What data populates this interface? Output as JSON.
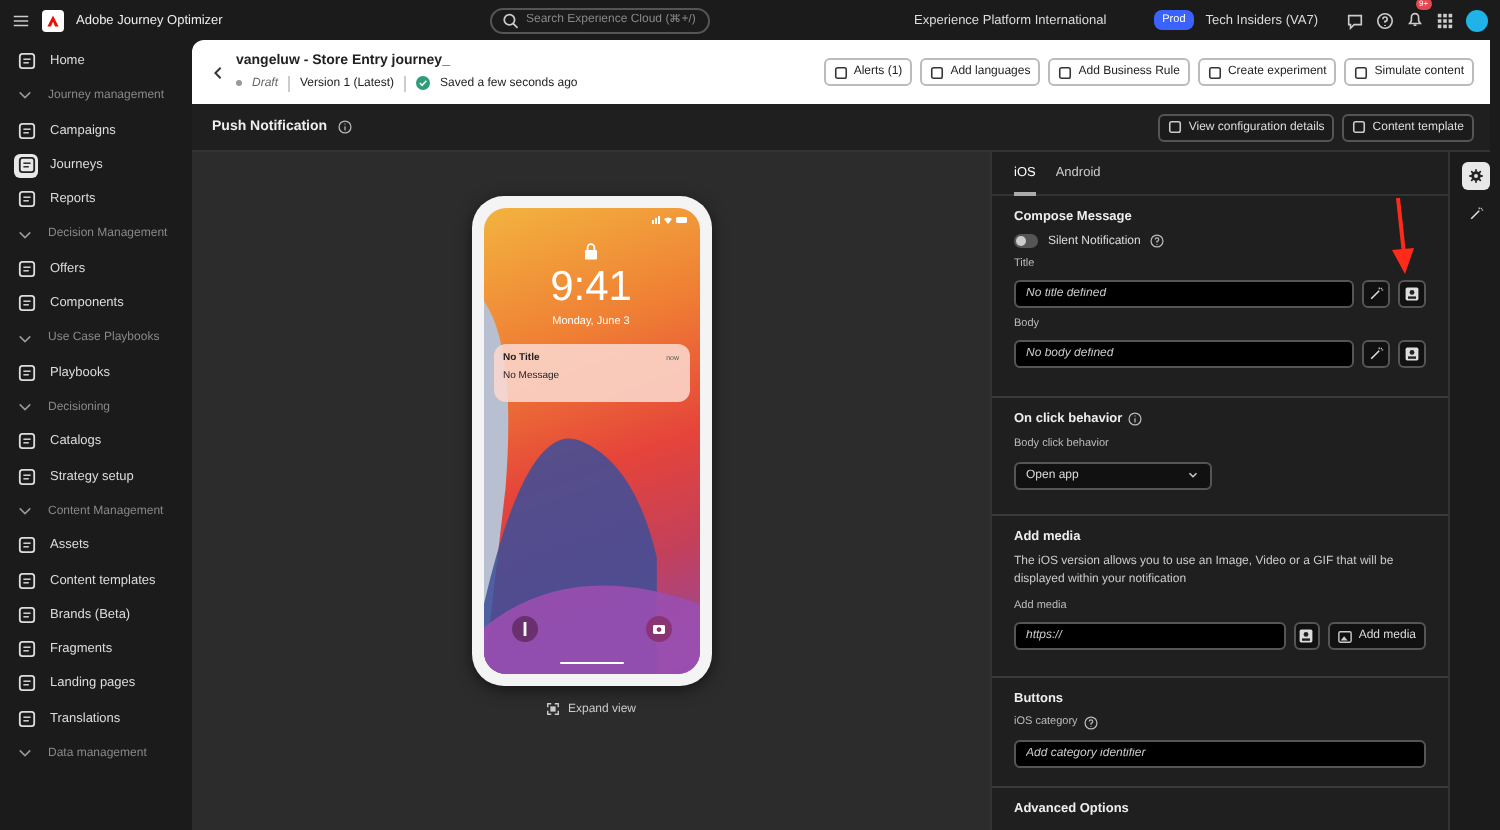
{
  "top_bar": {
    "app_name": "Adobe Journey Optimizer",
    "search": {
      "placeholder": "Search Experience Cloud (⌘+/)"
    },
    "org": "Experience Platform International",
    "env_badge": "Prod",
    "sandbox": "Tech Insiders (VA7)",
    "notification_count": "9+"
  },
  "sidebar": {
    "items": [
      {
        "kind": "item",
        "label": "Home",
        "selected": false
      },
      {
        "kind": "heading",
        "label": "Journey management",
        "expanded": true
      },
      {
        "kind": "item",
        "label": "Campaigns",
        "selected": false
      },
      {
        "kind": "item",
        "label": "Journeys",
        "selected": true
      },
      {
        "kind": "item",
        "label": "Reports",
        "selected": false
      },
      {
        "kind": "heading",
        "label": "Decision Management",
        "expanded": true
      },
      {
        "kind": "item",
        "label": "Offers",
        "selected": false
      },
      {
        "kind": "item",
        "label": "Components",
        "selected": false
      },
      {
        "kind": "heading",
        "label": "Use Case Playbooks",
        "expanded": true
      },
      {
        "kind": "item",
        "label": "Playbooks",
        "selected": false
      },
      {
        "kind": "heading",
        "label": "Decisioning",
        "expanded": true
      },
      {
        "kind": "item",
        "label": "Catalogs",
        "selected": false
      },
      {
        "kind": "item",
        "label": "Strategy setup",
        "selected": false
      },
      {
        "kind": "heading",
        "label": "Content Management",
        "expanded": true
      },
      {
        "kind": "item",
        "label": "Assets",
        "selected": false
      },
      {
        "kind": "item",
        "label": "Content templates",
        "selected": false
      },
      {
        "kind": "item",
        "label": "Brands (Beta)",
        "selected": false
      },
      {
        "kind": "item",
        "label": "Fragments",
        "selected": false
      },
      {
        "kind": "item",
        "label": "Landing pages",
        "selected": false
      },
      {
        "kind": "item",
        "label": "Translations",
        "selected": false
      },
      {
        "kind": "heading",
        "label": "Data management",
        "expanded": true
      }
    ]
  },
  "header": {
    "title": "vangeluw - Store Entry journey_",
    "status": "Draft",
    "version": "Version 1 (Latest)",
    "save_status": "Saved a few seconds ago",
    "buttons": [
      "Alerts (1)",
      "Add languages",
      "Add Business Rule",
      "Create experiment",
      "Simulate content"
    ]
  },
  "subheader": {
    "title": "Push Notification",
    "buttons": [
      "View configuration details",
      "Content template"
    ]
  },
  "preview": {
    "time": "9:41",
    "date": "Monday, June 3",
    "notification": {
      "title": "No Title",
      "time": "now",
      "message": "No Message"
    },
    "expand_label": "Expand view"
  },
  "tabs": [
    {
      "label": "iOS",
      "selected": true
    },
    {
      "label": "Android",
      "selected": false
    }
  ],
  "compose": {
    "heading": "Compose Message",
    "silent_toggle": {
      "label": "Silent Notification",
      "on": false
    },
    "title_field": {
      "label": "Title",
      "placeholder": "No title defined"
    },
    "body_field": {
      "label": "Body",
      "placeholder": "No body defined"
    }
  },
  "on_click": {
    "heading": "On click behavior",
    "label": "Body click behavior",
    "value": "Open app"
  },
  "media": {
    "heading": "Add media",
    "description": "The iOS version allows you to use an Image, Video or a GIF that will be displayed within your notification",
    "label": "Add media",
    "placeholder": "https://",
    "button": "Add media"
  },
  "buttons_section": {
    "heading": "Buttons",
    "label": "iOS category",
    "placeholder": "Add category identifier"
  },
  "advanced": {
    "heading": "Advanced Options"
  }
}
